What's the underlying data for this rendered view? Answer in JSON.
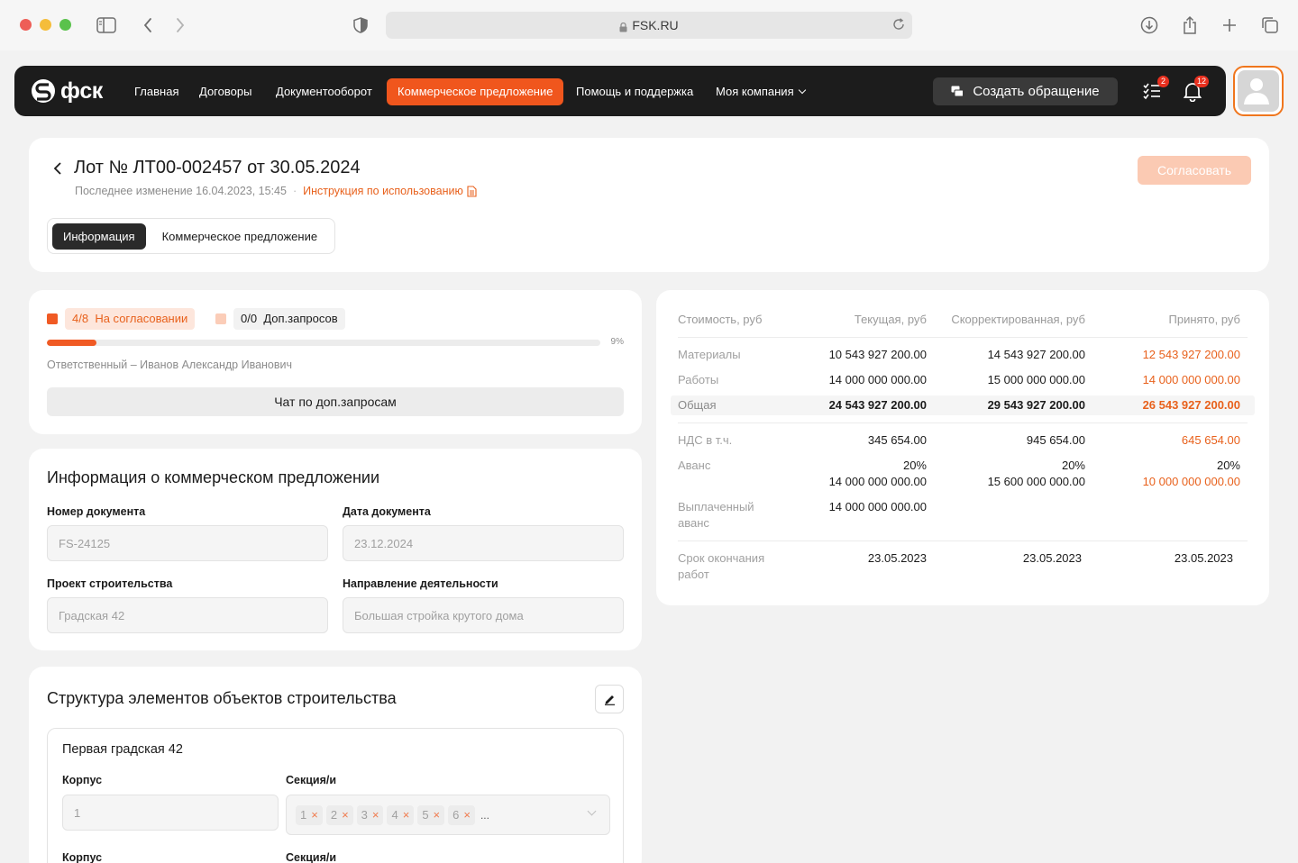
{
  "browser": {
    "url": "FSK.RU"
  },
  "nav": {
    "logo": "фск",
    "items": [
      "Главная",
      "Договоры",
      "Документооборот",
      "Коммерческое предложение",
      "Помощь и поддержка",
      "Моя компания"
    ],
    "active_index": 3,
    "create_label": "Создать обращение",
    "tasks_badge": "2",
    "notifications_badge": "12"
  },
  "header": {
    "title": "Лот № ЛТ00-002457 от 30.05.2024",
    "last_change": "Последнее изменение 16.04.2023, 15:45",
    "separator": "·",
    "instruction_link": "Инструкция по использованию",
    "approve_label": "Согласовать",
    "tabs": [
      "Информация",
      "Коммерческое предложение"
    ]
  },
  "status": {
    "approval_count": "4/8",
    "approval_label": "На согласовании",
    "requests_count": "0/0",
    "requests_label": "Доп.запросов",
    "progress_percent": 9,
    "progress_label": "9%",
    "responsible": "Ответственный  – Иванов Александр Иванович",
    "chat_label": "Чат по доп.запросам"
  },
  "info": {
    "title": "Информация о коммерческом предложении",
    "fields": [
      {
        "label": "Номер документа",
        "value": "FS-24125"
      },
      {
        "label": "Дата документа",
        "value": "23.12.2024"
      },
      {
        "label": "Проект строительства",
        "value": "Градская 42"
      },
      {
        "label": "Направление деятельности",
        "value": "Большая стройка крутого дома"
      }
    ]
  },
  "structure": {
    "title": "Структура элементов объектов строительства",
    "object_title": "Первая градская 42",
    "korpus_label": "Корпус",
    "korpus_value": "1",
    "sections_label": "Секция/и",
    "sections": [
      "1",
      "2",
      "3",
      "4",
      "5",
      "6"
    ],
    "sections_more": "...",
    "tag_remove": "×"
  },
  "costs": {
    "headers": [
      "Стоимость, руб",
      "Текущая, руб",
      "Скорректированная, руб",
      "Принято, руб"
    ],
    "rows": [
      {
        "label": "Материалы",
        "current": "10 543 927 200.00",
        "corrected": "14 543 927 200.00",
        "accepted": "12 543 927 200.00"
      },
      {
        "label": "Работы",
        "current": "14 000 000 000.00",
        "corrected": "15 000 000 000.00",
        "accepted": "14 000 000 000.00"
      },
      {
        "label": "Общая",
        "current": "24 543 927 200.00",
        "corrected": "29 543 927 200.00",
        "accepted": "26 543 927 200.00"
      },
      {
        "label": "НДС в т.ч.",
        "current": "345 654.00",
        "corrected": "945 654.00",
        "accepted": "645 654.00"
      },
      {
        "label": "Аванс",
        "current_pct": "20%",
        "current": "14 000 000 000.00",
        "corrected_pct": "20%",
        "corrected": "15 600 000 000.00",
        "accepted_pct": "20%",
        "accepted": "10 000 000 000.00"
      },
      {
        "label_1": "Выплаченный",
        "label_2": "аванс",
        "current": "14 000 000 000.00"
      },
      {
        "label_1": "Срок окончания",
        "label_2": "работ",
        "current": "23.05.2023",
        "corrected": "23.05.2023",
        "accepted": "23.05.2023"
      }
    ]
  },
  "colors": {
    "accent": "#f0561d",
    "nav_bg": "#1c1c1c",
    "accepted_text": "#e8611c"
  }
}
